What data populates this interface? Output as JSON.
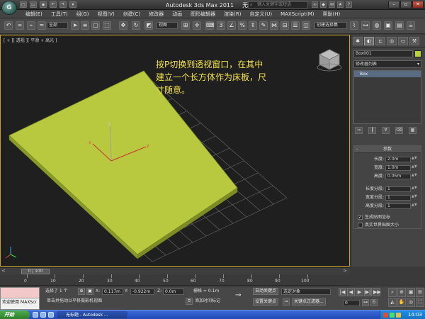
{
  "titlebar": {
    "app_title": "Autodesk 3ds Max  2011",
    "doc_title": "无标题",
    "search_placeholder": "键入关键字或短语",
    "logo_glyph": "G"
  },
  "menu": [
    "编辑(E)",
    "工具(T)",
    "组(G)",
    "视图(V)",
    "创建(C)",
    "修改器",
    "动画",
    "图形编辑器",
    "渲染(R)",
    "自定义(U)",
    "MAXScript(M)",
    "帮助(H)"
  ],
  "toolbar": {
    "selection_filter": "全部",
    "reference_coord": "视图",
    "named_selection": "创建选择集"
  },
  "viewport": {
    "label": "[ + ][ 透视 ][ 平滑 + 高光 ]",
    "note_lines": [
      "按P切换到透视窗口，在其中",
      "建立一个长方体作为床板，尺",
      "寸随意。"
    ],
    "plane_color": "#b8c93f"
  },
  "command_panel": {
    "object_name": "Box001",
    "object_color": "#b8d23a",
    "modifier_list": "修改器列表",
    "stack_items": [
      "Box"
    ],
    "rollout_title": "参数",
    "params": [
      {
        "label": "长度:",
        "value": "2.0m"
      },
      {
        "label": "宽度:",
        "value": "1.0m"
      },
      {
        "label": "高度:",
        "value": "0.05m"
      }
    ],
    "segments": [
      {
        "label": "长度分段:",
        "value": "1"
      },
      {
        "label": "宽度分段:",
        "value": "1"
      },
      {
        "label": "高度分段:",
        "value": "1"
      }
    ],
    "checkboxes": [
      {
        "label": "生成贴图坐标",
        "checked": true
      },
      {
        "label": "真实世界贴图大小",
        "checked": false
      }
    ]
  },
  "timeline": {
    "slider_label": "0 / 100",
    "ruler_ticks": [
      "0",
      "10",
      "20",
      "30",
      "40",
      "50",
      "60",
      "70",
      "80",
      "90",
      "100"
    ]
  },
  "status": {
    "maxscript_label": "欢迎使用 MAXScr",
    "selection_info": "选择了 1 个",
    "prompt": "单击并拖动以平移摄影机视图",
    "x_label": "X:",
    "x_value": "0.117m",
    "y_label": "Y:",
    "y_value": "-0.922m",
    "z_label": "Z:",
    "z_value": "0.0m",
    "grid": "栅格 = 0.1m",
    "add_time_tag": "添加时间标记",
    "auto_key": "自动关键点",
    "set_key": "设置关键点",
    "key_mode": "选定对象",
    "key_filters": "关键点过滤器...",
    "frame": "0"
  },
  "taskbar": {
    "start": "开始",
    "tasks": [
      "无标题 - Autodesk ..."
    ],
    "clock": "14:03"
  }
}
